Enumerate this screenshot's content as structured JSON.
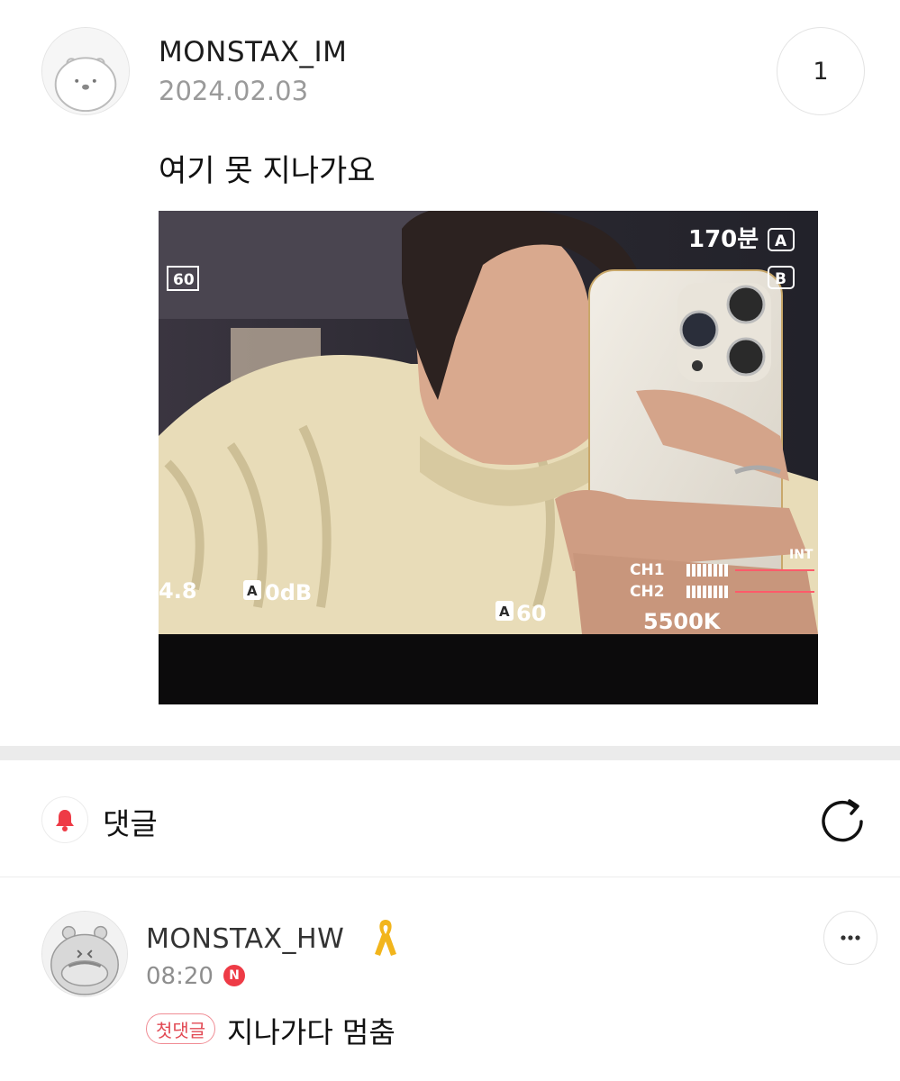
{
  "post": {
    "author": "MONSTAX_IM",
    "date": "2024.02.03",
    "count": "1",
    "text": "여기 못 지나가요",
    "avatar_icon": "bear-avatar-icon",
    "photo": {
      "description_icon": "photo-image",
      "hud": {
        "time_remaining": "170분",
        "slot_a": "A",
        "slot_b": "B",
        "fps_badge": "60",
        "aperture": "4.8",
        "gain": "0dB",
        "shutter": "60",
        "auto_label": "A",
        "ch1": "CH1",
        "ch2": "CH2",
        "mic": "INT",
        "white_balance": "5500K"
      }
    }
  },
  "comments_header": {
    "title": "댓글",
    "bell_icon": "bell-icon",
    "refresh_icon": "refresh-icon"
  },
  "comment": {
    "author": "MONSTAX_HW",
    "time": "08:20",
    "new_badge": "N",
    "first_tag": "첫댓글",
    "text": "지나가다 멈춤",
    "ribbon_icon": "yellow-ribbon-icon",
    "avatar_icon": "hippo-avatar-icon",
    "more_icon": "more-icon"
  },
  "colors": {
    "accent_red": "#ee3b46",
    "date_gray": "#9a9a9a",
    "divider": "#ebebeb",
    "ribbon_yellow": "#f2b51c"
  }
}
